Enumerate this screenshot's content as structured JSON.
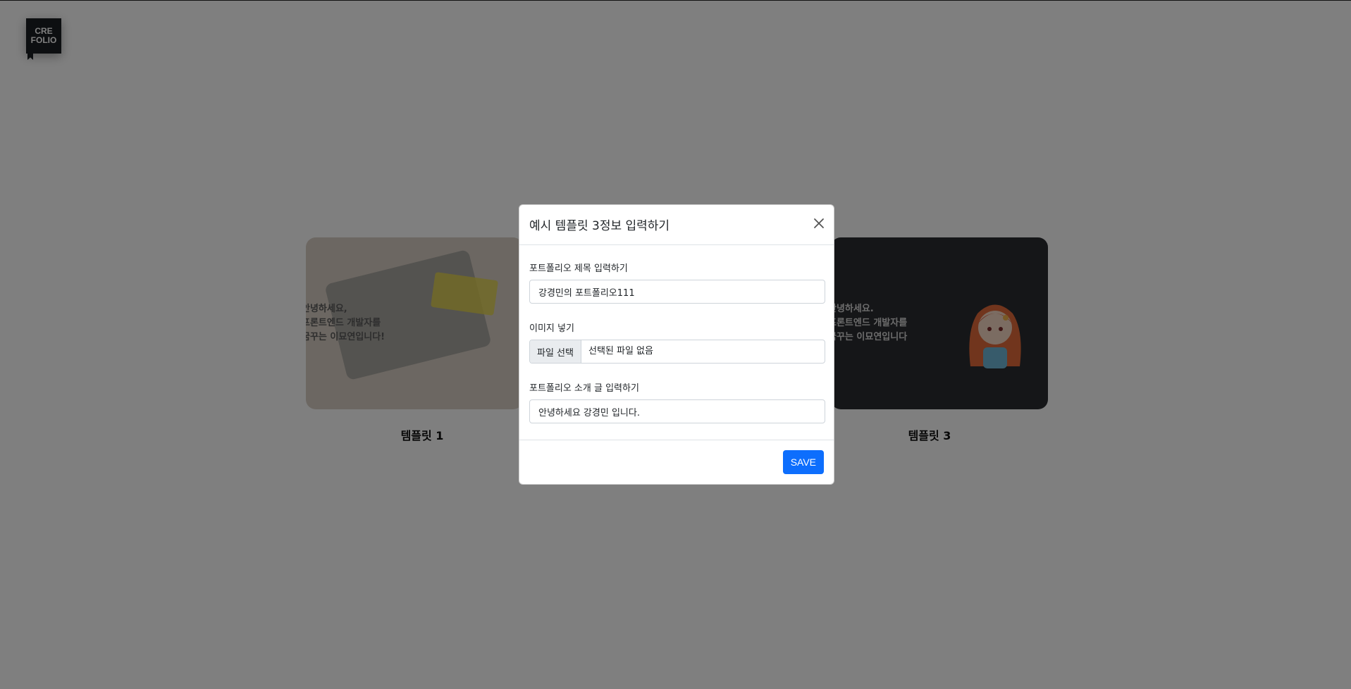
{
  "logo": {
    "line1": "CRE",
    "line2": "FOLIO"
  },
  "templates": [
    {
      "label": "템플릿 1",
      "text": [
        "안녕하세요,",
        "프론트엔드 개발자를",
        "꿈꾸는 이묘연입니다!"
      ]
    },
    {
      "label": "템플릿 3",
      "text": [
        "안녕하세요.",
        "프론트엔드 개발자를",
        "꿈꾸는 이묘연입니다"
      ]
    }
  ],
  "modal": {
    "title": "예시 템플릿 3정보 입력하기",
    "fields": {
      "title_label": "포트폴리오 제목 입력하기",
      "title_value": "강경민의 포트폴리오111",
      "image_label": "이미지 넣기",
      "file_button": "파일 선택",
      "file_status": "선택된 파일 없음",
      "intro_label": "포트폴리오 소개 글 입력하기",
      "intro_value": "안녕하세요 강경민 입니다."
    },
    "save_label": "SAVE"
  }
}
